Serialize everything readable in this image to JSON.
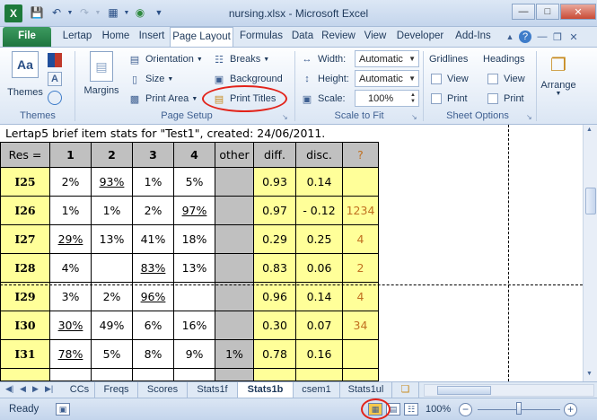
{
  "window": {
    "title": "nursing.xlsx - Microsoft Excel",
    "app_logo": "X",
    "controls": [
      "minimize",
      "maximize",
      "close"
    ]
  },
  "ribbon_tabs": [
    {
      "label": "File"
    },
    {
      "label": "Lertap"
    },
    {
      "label": "Home"
    },
    {
      "label": "Insert"
    },
    {
      "label": "Page Layout",
      "active": true
    },
    {
      "label": "Formulas"
    },
    {
      "label": "Data"
    },
    {
      "label": "Review"
    },
    {
      "label": "View"
    },
    {
      "label": "Developer"
    },
    {
      "label": "Add-Ins"
    }
  ],
  "ribbon": {
    "themes": {
      "themes_label": "Themes",
      "group_label": "Themes"
    },
    "page_setup": {
      "margins": "Margins",
      "orientation": "Orientation",
      "size": "Size",
      "print_area": "Print Area",
      "breaks": "Breaks",
      "background": "Background",
      "print_titles": "Print Titles",
      "group_label": "Page Setup"
    },
    "scale_to_fit": {
      "width_label": "Width:",
      "width_value": "Automatic",
      "height_label": "Height:",
      "height_value": "Automatic",
      "scale_label": "Scale:",
      "scale_value": "100%",
      "group_label": "Scale to Fit"
    },
    "sheet_options": {
      "gridlines": "Gridlines",
      "headings": "Headings",
      "view": "View",
      "print": "Print",
      "group_label": "Sheet Options"
    },
    "arrange": {
      "label": "Arrange"
    }
  },
  "sheet": {
    "title": "Lertap5 brief item stats for \"Test1\", created: 24/06/2011.",
    "header": [
      "Res =",
      "1",
      "2",
      "3",
      "4",
      "other",
      "diff.",
      "disc.",
      "?"
    ],
    "rows": [
      {
        "id": "I25",
        "c1": "2%",
        "c2": "93%",
        "c3": "1%",
        "c4": "5%",
        "other": "",
        "diff": "0.93",
        "disc": "0.14",
        "q": ""
      },
      {
        "id": "I26",
        "c1": "1%",
        "c2": "1%",
        "c3": "2%",
        "c4": "97%",
        "other": "",
        "diff": "0.97",
        "disc": "- 0.12",
        "q": "1234"
      },
      {
        "id": "I27",
        "c1": "29%",
        "c2": "13%",
        "c3": "41%",
        "c4": "18%",
        "other": "",
        "diff": "0.29",
        "disc": "0.25",
        "q": "4"
      },
      {
        "id": "I28",
        "c1": "4%",
        "c2": "",
        "c3": "83%",
        "c4": "13%",
        "other": "",
        "diff": "0.83",
        "disc": "0.06",
        "q": "2"
      },
      {
        "id": "I29",
        "c1": "3%",
        "c2": "2%",
        "c3": "96%",
        "c4": "",
        "other": "",
        "diff": "0.96",
        "disc": "0.14",
        "q": "4"
      },
      {
        "id": "I30",
        "c1": "30%",
        "c2": "49%",
        "c3": "6%",
        "c4": "16%",
        "other": "",
        "diff": "0.30",
        "disc": "0.07",
        "q": "34"
      },
      {
        "id": "I31",
        "c1": "78%",
        "c2": "5%",
        "c3": "8%",
        "c4": "9%",
        "other": "1%",
        "diff": "0.78",
        "disc": "0.16",
        "q": ""
      }
    ],
    "keyed": [
      "c2",
      "c4",
      "c1",
      "c3",
      "c3",
      "c1",
      "c1"
    ]
  },
  "sheet_tabs": [
    {
      "label": "CCs"
    },
    {
      "label": "Freqs"
    },
    {
      "label": "Scores"
    },
    {
      "label": "Stats1f"
    },
    {
      "label": "Stats1b",
      "active": true
    },
    {
      "label": "csem1"
    },
    {
      "label": "Stats1ul"
    }
  ],
  "status_bar": {
    "ready": "Ready",
    "zoom": "100%",
    "zoom_minus": "−",
    "zoom_plus": "+"
  },
  "colors": {
    "highlight_ring": "#e2231a",
    "item_cell": "#ffff99",
    "header_cell": "#c0c0c0",
    "flag_text": "#c07020"
  }
}
